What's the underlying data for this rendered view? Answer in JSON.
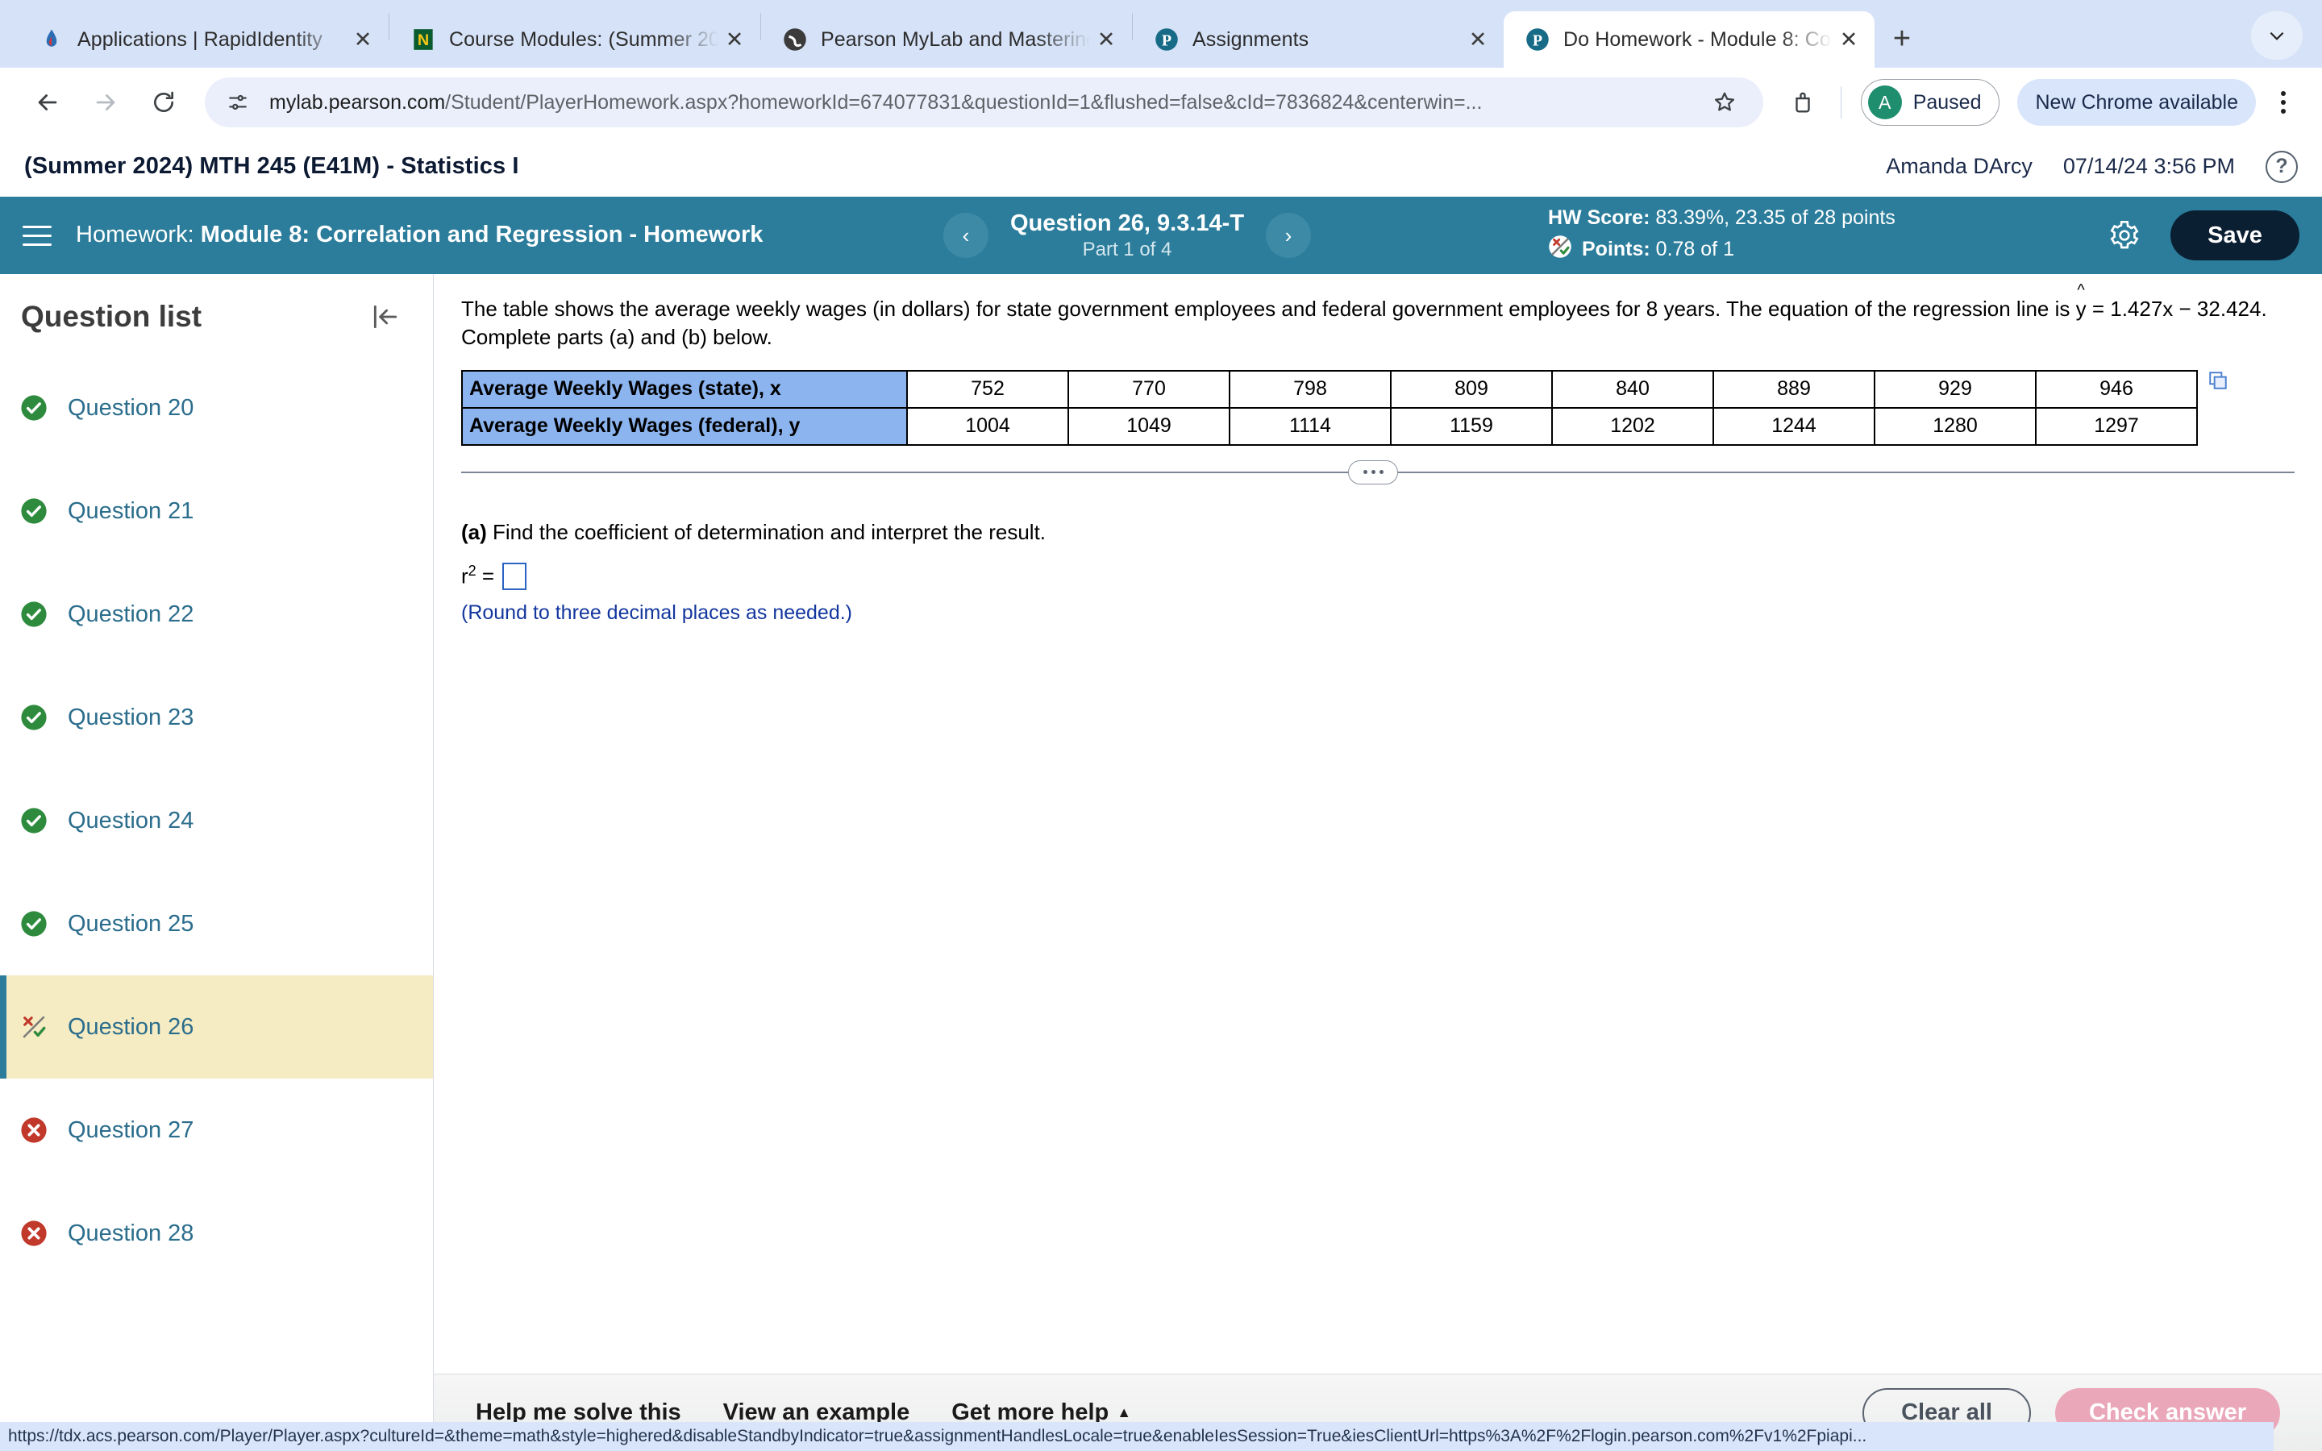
{
  "browser": {
    "tabs": [
      {
        "title": "Applications | RapidIdentity",
        "favicon": "rapididentity-icon",
        "active": false
      },
      {
        "title": "Course Modules: (Summer 20",
        "favicon": "canvas-n-icon",
        "active": false
      },
      {
        "title": "Pearson MyLab and Mastering",
        "favicon": "pearson-globe-icon",
        "active": false
      },
      {
        "title": "Assignments",
        "favicon": "pearson-p-icon",
        "active": false
      },
      {
        "title": "Do Homework - Module 8: Co",
        "favicon": "pearson-p-icon",
        "active": true
      }
    ],
    "new_tab_label": "+",
    "tab_list_chevron": "chevron-down-icon",
    "address": {
      "host": "mylab.pearson.com",
      "path": "/Student/PlayerHomework.aspx?homeworkId=674077831&questionId=1&flushed=false&cId=7836824&centerwin=...",
      "site_info_icon": "site-settings-icon",
      "bookmark_icon": "star-icon"
    },
    "extensions_icon": "extensions-icon",
    "profile": {
      "initial": "A",
      "label": "Paused"
    },
    "update_label": "New Chrome available",
    "menu_icon": "kebab-menu-icon",
    "back_icon": "back-arrow-icon",
    "forward_icon": "forward-arrow-icon",
    "reload_icon": "reload-icon"
  },
  "pearson_header": {
    "course_title": "(Summer 2024) MTH 245 (E41M) - Statistics I",
    "user_name": "Amanda DArcy",
    "datetime": "07/14/24 3:56 PM",
    "help_icon": "help-question-icon"
  },
  "hw_bar": {
    "menu_icon": "hamburger-menu-icon",
    "label": "Homework:",
    "assignment_name": "Module 8: Correlation and Regression - Homework",
    "prev_icon": "chevron-left-icon",
    "next_icon": "chevron-right-icon",
    "question_name": "Question 26, 9.3.14-T",
    "part_label": "Part 1 of 4",
    "hw_score_label": "HW Score:",
    "hw_score_value": "83.39%, 23.35 of 28 points",
    "points_icon": "partial-credit-icon",
    "points_label": "Points:",
    "points_value": "0.78 of 1",
    "settings_icon": "gear-icon",
    "save_label": "Save",
    "accent_color": "#2b7d9b"
  },
  "sidebar": {
    "title": "Question list",
    "collapse_icon": "collapse-panel-icon",
    "items": [
      {
        "label": "Question 20",
        "status": "correct",
        "icon": "check-circle-icon",
        "selected": false
      },
      {
        "label": "Question 21",
        "status": "correct",
        "icon": "check-circle-icon",
        "selected": false
      },
      {
        "label": "Question 22",
        "status": "correct",
        "icon": "check-circle-icon",
        "selected": false
      },
      {
        "label": "Question 23",
        "status": "correct",
        "icon": "check-circle-icon",
        "selected": false
      },
      {
        "label": "Question 24",
        "status": "correct",
        "icon": "check-circle-icon",
        "selected": false
      },
      {
        "label": "Question 25",
        "status": "correct",
        "icon": "check-circle-icon",
        "selected": false
      },
      {
        "label": "Question 26",
        "status": "partial",
        "icon": "partial-credit-icon",
        "selected": true
      },
      {
        "label": "Question 27",
        "status": "incorrect",
        "icon": "x-circle-icon",
        "selected": false
      },
      {
        "label": "Question 28",
        "status": "incorrect",
        "icon": "x-circle-icon",
        "selected": false
      }
    ],
    "colors": {
      "correct": "#2e8b3d",
      "incorrect": "#c0392b",
      "selected_bg": "#f6ecc4",
      "link": "#2b6d8c"
    }
  },
  "question": {
    "prompt_part1": "The table shows the average weekly wages (in dollars) for state government employees and federal government employees for 8 years. The equation of the regression line is ",
    "y_symbol": "y",
    "hat_symbol": "^",
    "prompt_part2": " = 1.427x − 32.424. Complete parts (a) and (b) below.",
    "copy_icon": "copy-table-icon",
    "splitter_icon": "drag-handle-dots",
    "part_a_label": "(a)",
    "part_a_text": " Find the coefficient of determination and interpret the result.",
    "r2_label": "r",
    "r2_exp": "2",
    "r2_equals": "=",
    "answer_value": "",
    "round_note": "(Round to three decimal places as needed.)"
  },
  "chart_data": {
    "type": "table",
    "title": "Average Weekly Wages",
    "row_headers": [
      "Average Weekly Wages (state), x",
      "Average Weekly Wages (federal), y"
    ],
    "series": [
      {
        "name": "Average Weekly Wages (state), x",
        "values": [
          752,
          770,
          798,
          809,
          840,
          889,
          929,
          946
        ]
      },
      {
        "name": "Average Weekly Wages (federal), y",
        "values": [
          1004,
          1049,
          1114,
          1159,
          1202,
          1244,
          1280,
          1297
        ]
      }
    ],
    "n": 8,
    "regression_line": "y = 1.427x - 32.424",
    "xlabel": "Average Weekly Wages (state), x",
    "ylabel": "Average Weekly Wages (federal), y"
  },
  "bottom_bar": {
    "help_solve": "Help me solve this",
    "view_example": "View an example",
    "get_more_help": "Get more help",
    "get_more_help_caret": "▲",
    "clear_all": "Clear all",
    "check_answer": "Check answer"
  },
  "status_bar": {
    "url": "https://tdx.acs.pearson.com/Player/Player.aspx?cultureId=&theme=math&style=highered&disableStandbyIndicator=true&assignmentHandlesLocale=true&enableIesSession=True&iesClientUrl=https%3A%2F%2Flogin.pearson.com%2Fv1%2Fpiapi..."
  }
}
